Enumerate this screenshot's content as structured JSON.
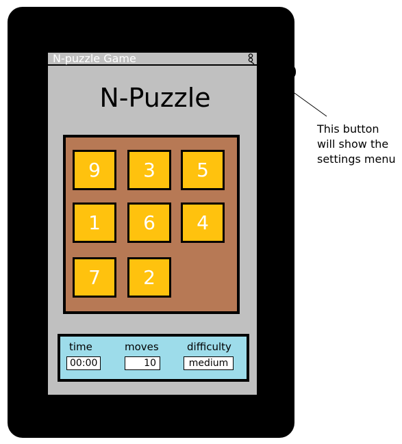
{
  "window": {
    "title": "N-puzzle Game",
    "settings_icon": "settings-icon"
  },
  "app": {
    "heading": "N-Puzzle"
  },
  "board": {
    "tiles": [
      {
        "label": "9"
      },
      {
        "label": "3"
      },
      {
        "label": "5"
      },
      {
        "label": "1"
      },
      {
        "label": "6"
      },
      {
        "label": "4"
      },
      {
        "label": "7"
      },
      {
        "label": "2"
      }
    ]
  },
  "status": {
    "time_label": "time",
    "time_value": "00:00",
    "moves_label": "moves",
    "moves_value": "10",
    "difficulty_label": "difficulty",
    "difficulty_value": "medium"
  },
  "annotation": {
    "text": "This button will show the settings menu"
  },
  "colors": {
    "screen": "#c0c0c0",
    "board": "#b77955",
    "tile": "#ffc20e",
    "status_panel": "#9ddcea"
  }
}
